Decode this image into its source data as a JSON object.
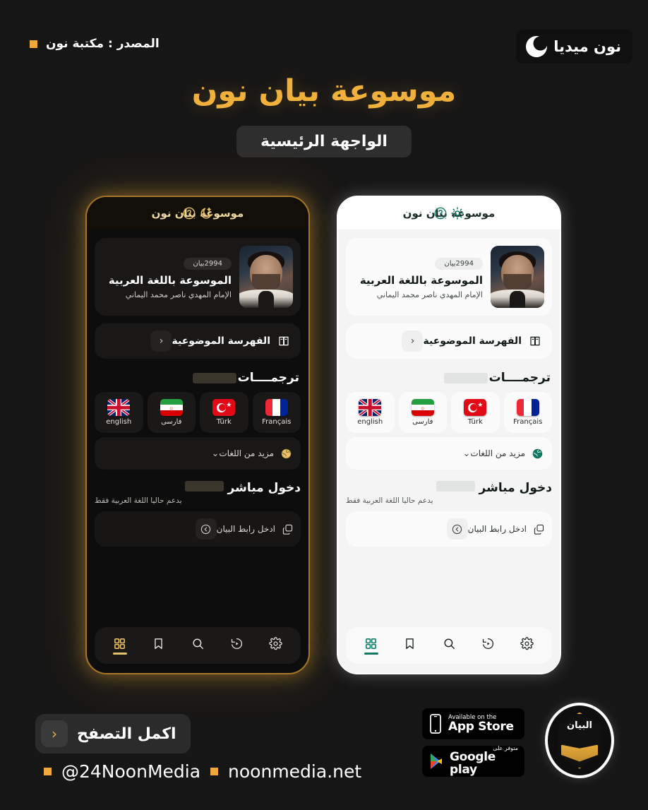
{
  "header": {
    "brand_name": "نون ميديا",
    "brand_icon": "crescent-circle-icon",
    "source_label": "المصدر : مكتبة نون",
    "bullet_color": "#f0a83a"
  },
  "title": {
    "main": "موسوعة بيان نون",
    "main_color": "#f0b13c",
    "badge": "الواجهة الرئيسية"
  },
  "phones": {
    "dark": {
      "theme_label": "dark",
      "appbar": {
        "left_icon": "moon-star-icon",
        "title": "موسوعة بيان نون",
        "right_icon": "help-circle-icon"
      },
      "hero": {
        "badge": "2994بيان",
        "heading": "الموسوعة باللغة العربية",
        "subtitle": "الإمام المهدي ناصر محمد اليماني",
        "avatar": "portrait-image"
      },
      "index_row": {
        "icon": "index-book-icon",
        "label": "الفهرسة الموضوعية",
        "chevron": "‹"
      },
      "translations": {
        "heading": "ترجمــــات",
        "items": [
          {
            "flag": "flag-fr",
            "label": "Français"
          },
          {
            "flag": "flag-tr",
            "label": "Türk"
          },
          {
            "flag": "flag-ir",
            "label": "فارسى"
          },
          {
            "flag": "flag-gb",
            "label": "english"
          }
        ],
        "more": {
          "icon": "globe-icon",
          "label": "مزيد من اللغات",
          "chevron": "⌄"
        }
      },
      "direct_entry": {
        "heading": "دخول مباشر",
        "subtitle": "يدعم حاليا اللغة العربية فقط",
        "row": {
          "icon": "copy-icon",
          "label": "ادخل رابط البيان",
          "action_icon": "arrow-left-circle-icon"
        }
      },
      "nav": [
        {
          "icon": "gear-icon",
          "name": "settings",
          "active": false
        },
        {
          "icon": "history-icon",
          "name": "history",
          "active": false
        },
        {
          "icon": "search-icon",
          "name": "search",
          "active": false
        },
        {
          "icon": "bookmark-icon",
          "name": "bookmarks",
          "active": false
        },
        {
          "icon": "grid-icon",
          "name": "home",
          "active": true
        }
      ],
      "accent": "#e8c069"
    },
    "light": {
      "theme_label": "light",
      "appbar": {
        "left_icon": "sun-icon",
        "title": "موسوعة بيان نون",
        "right_icon": "help-circle-icon"
      },
      "hero": {
        "badge": "2994بيان",
        "heading": "الموسوعة باللغة العربية",
        "subtitle": "الإمام المهدي ناصر محمد اليماني",
        "avatar": "portrait-image"
      },
      "index_row": {
        "icon": "index-book-icon",
        "label": "الفهرسة الموضوعية",
        "chevron": "‹"
      },
      "translations": {
        "heading": "ترجمــــات",
        "items": [
          {
            "flag": "flag-fr",
            "label": "Français"
          },
          {
            "flag": "flag-tr",
            "label": "Türk"
          },
          {
            "flag": "flag-ir",
            "label": "فارسى"
          },
          {
            "flag": "flag-gb",
            "label": "english"
          }
        ],
        "more": {
          "icon": "globe-icon",
          "label": "مزيد من اللغات",
          "chevron": "⌄"
        }
      },
      "direct_entry": {
        "heading": "دخول مباشر",
        "subtitle": "يدعم حاليا اللغة العربية فقط",
        "row": {
          "icon": "copy-icon",
          "label": "ادخل رابط البيان",
          "action_icon": "arrow-left-circle-icon"
        }
      },
      "nav": [
        {
          "icon": "gear-icon",
          "name": "settings",
          "active": false
        },
        {
          "icon": "history-icon",
          "name": "history",
          "active": false
        },
        {
          "icon": "search-icon",
          "name": "search",
          "active": false
        },
        {
          "icon": "bookmark-icon",
          "name": "bookmarks",
          "active": false
        },
        {
          "icon": "grid-icon",
          "name": "home",
          "active": true
        }
      ],
      "accent": "#0f7a63"
    }
  },
  "footer": {
    "browse_button": {
      "label": "اكمل التصفح",
      "chevron": "‹"
    },
    "social_handle": "@24NoonMedia",
    "website": "noonmedia.net",
    "app_store": {
      "small": "Available on the",
      "big": "App Store",
      "icon": "iphone-icon"
    },
    "google_play": {
      "arabic": "متوفر على",
      "big": "Google play",
      "icon": "play-triangle-icon"
    },
    "bayan_logo_word": "البيان"
  }
}
